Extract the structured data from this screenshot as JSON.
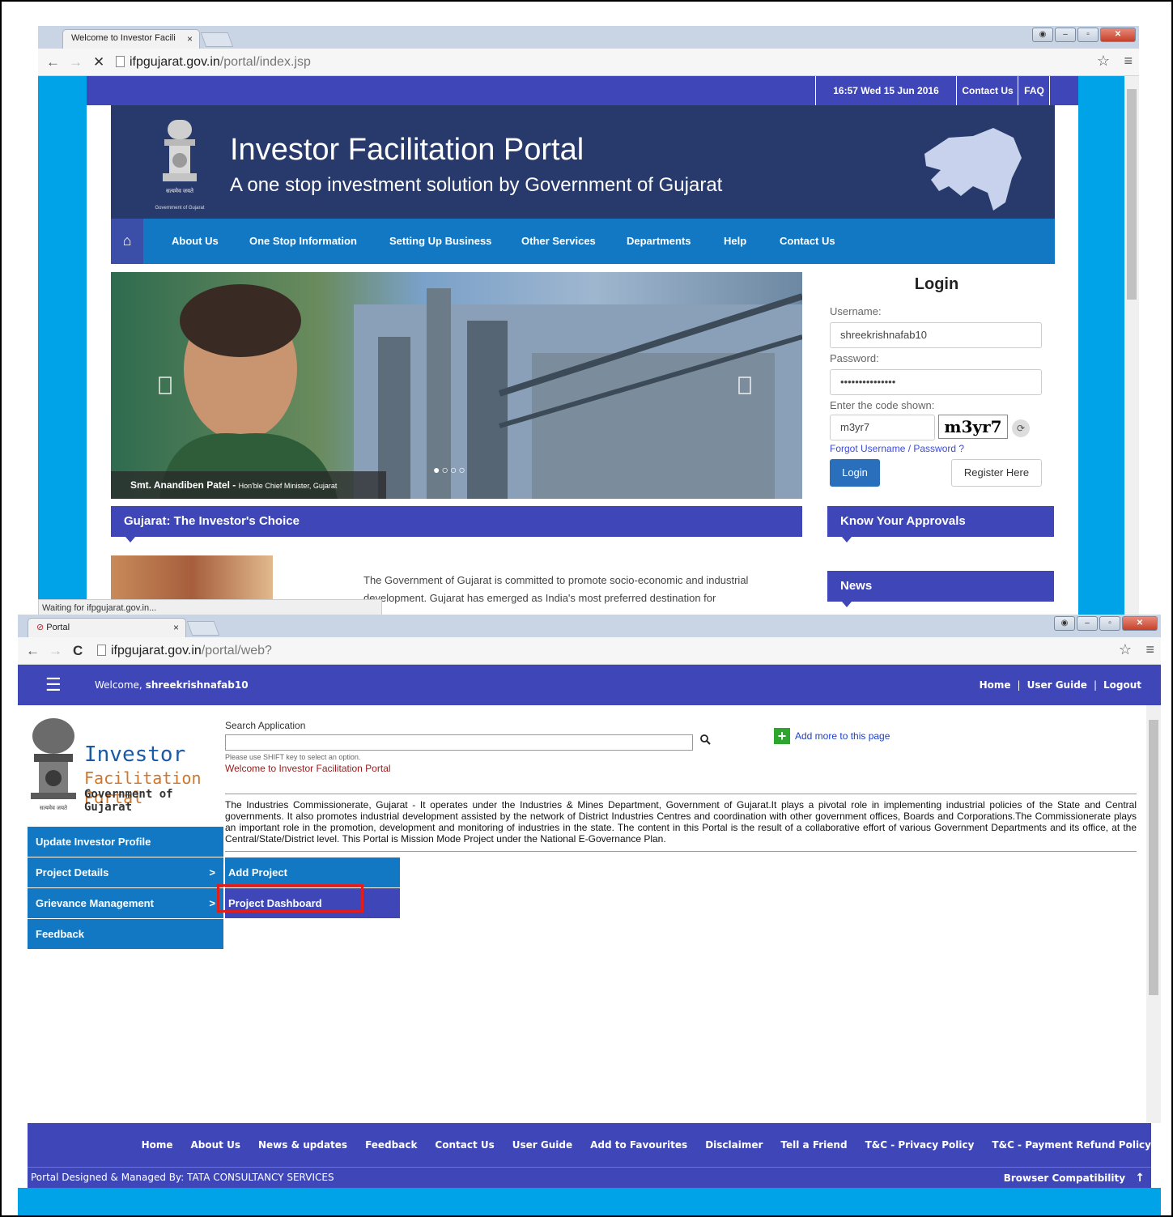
{
  "window1": {
    "tab_title": "Welcome to Investor Facili",
    "tab_close": "×",
    "url_host": "ifpgujarat.gov.in",
    "url_path": "/portal/index.jsp",
    "topbar": {
      "datetime": "16:57  Wed  15 Jun 2016",
      "contact": "Contact Us",
      "faq": "FAQ"
    },
    "banner": {
      "title": "Investor Facilitation Portal",
      "subtitle": "A one stop investment solution by Government of Gujarat",
      "emblem_caption": "Government of Gujarat"
    },
    "nav": [
      "About Us",
      "One Stop Information",
      "Setting Up Business",
      "Other Services",
      "Departments",
      "Help",
      "Contact Us"
    ],
    "slider": {
      "caption_name": "Smt. Anandiben Patel - ",
      "caption_role": "Hon'ble Chief Minister, Gujarat",
      "dots": "●○○○"
    },
    "login": {
      "title": "Login",
      "username_label": "Username:",
      "username_value": "shreekrishnafab10",
      "password_label": "Password:",
      "password_value": "•••••••••••••••",
      "code_label": "Enter the code shown:",
      "code_value": "m3yr7",
      "captcha": "m3yr7",
      "forgot": "Forgot Username / Password ?",
      "login_button": "Login",
      "register_button": "Register Here"
    },
    "sections": {
      "investor_choice": "Gujarat: The Investor's Choice",
      "know_approvals": "Know Your Approvals",
      "news": "News"
    },
    "paragraph": "The Government of Gujarat is committed to promote socio-economic and industrial development. Gujarat has emerged as India's most preferred destination for",
    "status": "Waiting for ifpgujarat.gov.in..."
  },
  "window2": {
    "tab_title": "Portal",
    "tab_close": "×",
    "url_host": "ifpgujarat.gov.in",
    "url_path": "/portal/web?",
    "header": {
      "welcome_label": "Welcome,",
      "username": "shreekrishnafab10",
      "links": [
        "Home",
        "User Guide",
        "Logout"
      ]
    },
    "logo": {
      "line1": "Investor",
      "line2": "Facilitation Portal",
      "line3": "Government of Gujarat"
    },
    "search": {
      "label": "Search Application",
      "hint": "Please use SHIFT key to select an option.",
      "welcome": "Welcome to Investor Facilitation Portal"
    },
    "add_more": "Add more to this page",
    "paragraph": "The Industries Commissionerate, Gujarat - It operates under the Industries & Mines Department, Government of Gujarat.It plays a pivotal role in implementing industrial policies of the State and Central governments. It also promotes industrial development assisted by the network of District Industries Centres and coordination with other government offices, Boards and Corporations.The Commissionerate plays an important role in the promotion, development and monitoring of industries in the state. The content in this Portal is the result of a collaborative effort of various Government Departments and its office, at the Central/State/District level. This Portal is Mission Mode Project under the National E-Governance Plan.",
    "side_menu": [
      {
        "label": "Update Investor Profile",
        "arrow": ""
      },
      {
        "label": "Project Details",
        "arrow": ">"
      },
      {
        "label": "Grievance Management",
        "arrow": ">"
      },
      {
        "label": "Feedback",
        "arrow": ""
      }
    ],
    "submenu": [
      "Add Project",
      "Project Dashboard"
    ],
    "footer": {
      "links": [
        "Home",
        "About Us",
        "News & updates",
        "Feedback",
        "Contact Us",
        "User Guide",
        "Add to Favourites",
        "Disclaimer",
        "Tell a Friend",
        "T&C - Privacy Policy",
        "T&C - Payment Refund Policy"
      ],
      "credit": "Portal Designed & Managed By: TATA CONSULTANCY SERVICES",
      "compat": "Browser Compatibility",
      "up_arrow": "↑"
    }
  },
  "colors": {
    "portal_blue": "#3f47b8",
    "nav_blue": "#1278c4",
    "page_bg": "#00a3e8",
    "highlight_red": "#e01e1e"
  }
}
